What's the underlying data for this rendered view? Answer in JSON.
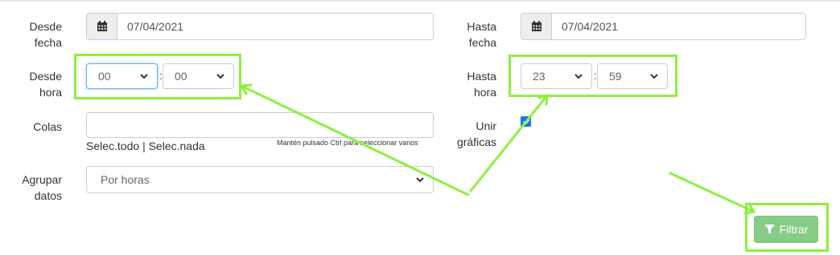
{
  "desde_fecha": {
    "label_line1": "Desde",
    "label_line2": "fecha",
    "value": "07/04/2021",
    "icon": "calendar-icon"
  },
  "hasta_fecha": {
    "label_line1": "Hasta",
    "label_line2": "fecha",
    "value": "07/04/2021",
    "icon": "calendar-icon"
  },
  "desde_hora": {
    "label_line1": "Desde",
    "label_line2": "hora",
    "hours": "00",
    "separator": ":",
    "minutes": "00"
  },
  "hasta_hora": {
    "label_line1": "Hasta",
    "label_line2": "hora",
    "hours": "23",
    "separator": ":",
    "minutes": "59"
  },
  "colas": {
    "label": "Colas",
    "select_all": "Selec.todo",
    "divider": "|",
    "select_none": "Selec.nada",
    "hint": "Mantén pulsado Ctrl para seleccionar varios"
  },
  "unir_graficas": {
    "label_line1": "Unir",
    "label_line2": "gráficas",
    "checked": true
  },
  "agrupar_datos": {
    "label_line1": "Agrupar",
    "label_line2": "datos",
    "value": "Por horas"
  },
  "filter_button": {
    "label": "Filtrar",
    "icon": "filter-icon"
  },
  "colors": {
    "highlight": "#8ef03f",
    "filter_button": "#86cc86",
    "checkbox": "#1a73e8"
  }
}
